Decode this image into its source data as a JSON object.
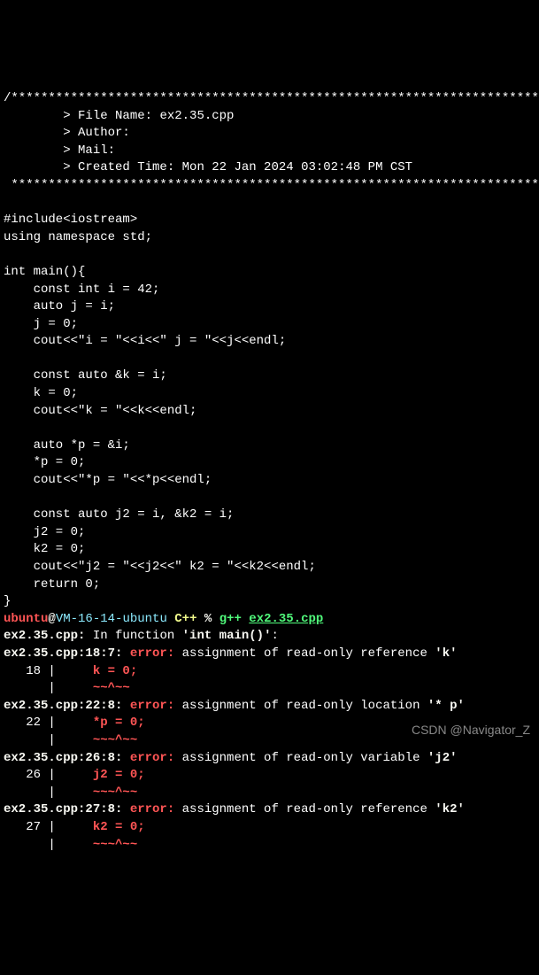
{
  "header": {
    "border_top": "/************************************************************************",
    "file_name_label": "        > File Name: ",
    "file_name": "ex2.35.cpp",
    "author_label": "        > Author:",
    "mail_label": "        > Mail:",
    "created_label": "        > Created Time: ",
    "created_time": "Mon 22 Jan 2024 03:02:48 PM CST",
    "border_bottom": " ***********************************************************************/"
  },
  "code": {
    "include": "#include<iostream>",
    "using": "using namespace std;",
    "main_sig": "int main(){",
    "l1": "    const int i = 42;",
    "l2": "    auto j = i;",
    "l3": "    j = 0;",
    "l4": "    cout<<\"i = \"<<i<<\" j = \"<<j<<endl;",
    "blank1": "",
    "l5": "    const auto &k = i;",
    "l6": "    k = 0;",
    "l7": "    cout<<\"k = \"<<k<<endl;",
    "blank2": "",
    "l8": "    auto *p = &i;",
    "l9": "    *p = 0;",
    "l10": "    cout<<\"*p = \"<<*p<<endl;",
    "blank3": "",
    "l11": "    const auto j2 = i, &k2 = i;",
    "l12": "    j2 = 0;",
    "l13": "    k2 = 0;",
    "l14": "    cout<<\"j2 = \"<<j2<<\" k2 = \"<<k2<<endl;",
    "l15": "    return 0;",
    "close": "}"
  },
  "prompt": {
    "user": "ubuntu",
    "at": "@",
    "host": "VM-16-14-ubuntu",
    "dir": " C++ ",
    "sep": "% ",
    "cmd": "g++ ",
    "file": "ex2.35.cpp"
  },
  "errors": {
    "e0": {
      "prefix": "ex2.35.cpp: ",
      "msg": "In function ",
      "func": "'int main()'",
      "colon": ":"
    },
    "e1": {
      "loc": "ex2.35.cpp:18:7: ",
      "err_label": "error: ",
      "msg": "assignment of read-only reference ",
      "var": "'k'",
      "line_num": "   18 | ",
      "code": "    k = 0;",
      "caret_prefix": "      | ",
      "caret": "    ~~^~~"
    },
    "e2": {
      "loc": "ex2.35.cpp:22:8: ",
      "err_label": "error: ",
      "msg": "assignment of read-only location ",
      "var": "'* p'",
      "line_num": "   22 | ",
      "code": "    *p = 0;",
      "caret_prefix": "      | ",
      "caret": "    ~~~^~~"
    },
    "e3": {
      "loc": "ex2.35.cpp:26:8: ",
      "err_label": "error: ",
      "msg": "assignment of read-only variable ",
      "var": "'j2'",
      "line_num": "   26 | ",
      "code": "    j2 = 0;",
      "caret_prefix": "      | ",
      "caret": "    ~~~^~~"
    },
    "e4": {
      "loc": "ex2.35.cpp:27:8: ",
      "err_label": "error: ",
      "msg": "assignment of read-only reference ",
      "var": "'k2'",
      "line_num": "   27 | ",
      "code": "    k2 = 0;",
      "caret_prefix": "      | ",
      "caret": "    ~~~^~~"
    }
  },
  "watermark": "CSDN @Navigator_Z"
}
